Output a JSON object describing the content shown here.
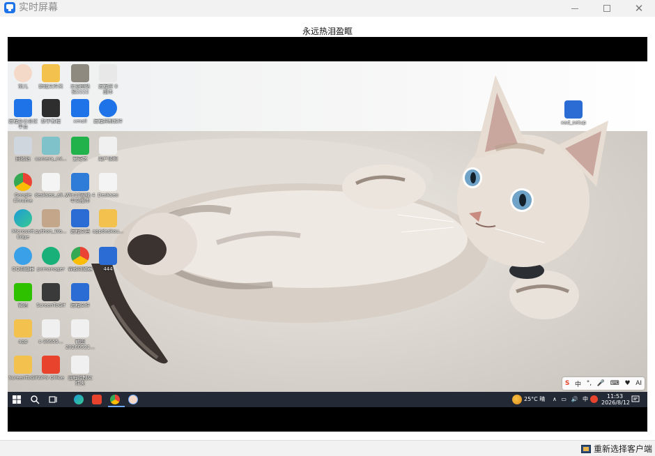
{
  "window": {
    "title": "实时屏幕",
    "remote_title": "永远热泪盈眶"
  },
  "desktop_icons": [
    {
      "label": "宝儿",
      "color": "#f4d8c8"
    },
    {
      "label": "新建文件夹",
      "color": "#f2c14e"
    },
    {
      "label": "示意图路\n径2222",
      "color": "#8f8a80"
    },
    {
      "label": "远程控 8\n副本",
      "color": "#e8e8e8"
    },
    {
      "label": "远程办公会议\n平台",
      "color": "#1e73e8"
    },
    {
      "label": "新手教程",
      "color": "#2e2e2e"
    },
    {
      "label": "xmall",
      "color": "#1e73e8"
    },
    {
      "label": "远程控制软件",
      "color": "#1e73e8"
    },
    {
      "label": "回收站",
      "color": "#cfd6de"
    },
    {
      "label": "camera_mi...",
      "color": "#7fc2c9"
    },
    {
      "label": "爱奇艺",
      "color": "#22b24c"
    },
    {
      "label": "用户须知",
      "color": "#f0f0f0"
    },
    {
      "label": "Google\nChrome",
      "color": "#ea4335"
    },
    {
      "label": "deskseo_ali...",
      "color": "#f4f4f4"
    },
    {
      "label": "Win10系统 4\n中文版本",
      "color": "#2f7bd8"
    },
    {
      "label": "Deskseo",
      "color": "#f4f4f4"
    },
    {
      "label": "Microsoft\nEdge",
      "color": "#1d9bd7"
    },
    {
      "label": "python_Wo...",
      "color": "#c4a78a"
    },
    {
      "label": "远程文档",
      "color": "#2b6cd4"
    },
    {
      "label": "appdeskou...",
      "color": "#f2c14e"
    },
    {
      "label": "QQ浏览器",
      "color": "#3aa0e8"
    },
    {
      "label": "pcmanager",
      "color": "#19b07a"
    },
    {
      "label": "谷歌浏览器",
      "color": "#fbbc05"
    },
    {
      "label": "444",
      "color": "#2b6cd4"
    },
    {
      "label": "微信",
      "color": "#2dc100"
    },
    {
      "label": "ScreenToGif",
      "color": "#3a3a3a"
    },
    {
      "label": "远程文件",
      "color": "#2b6cd4"
    },
    {
      "label": "app",
      "color": "#f2c14e"
    },
    {
      "label": "c-36655...",
      "color": "#f0f0f0"
    },
    {
      "label": "截图\n20260521...",
      "color": "#f0f0f0"
    },
    {
      "label": "ScreenToGif",
      "color": "#f2c14e"
    },
    {
      "label": "WPS Office",
      "color": "#e8432d"
    },
    {
      "label": "远程控制文\n件夹",
      "color": "#f0f0f0"
    },
    {
      "label": "xad_setup",
      "color": "#2b6cd4"
    }
  ],
  "ime": {
    "items": [
      "S",
      "中",
      "°,",
      "🎤",
      "⌨",
      "♥",
      "AI"
    ]
  },
  "taskbar": {
    "weather": "25°C 晴",
    "tray": "∧ ▭ 🔊 中",
    "time": "11:53",
    "date": "2026/8/12"
  },
  "statusbar": {
    "reselect_label": "重新选择客户端"
  }
}
